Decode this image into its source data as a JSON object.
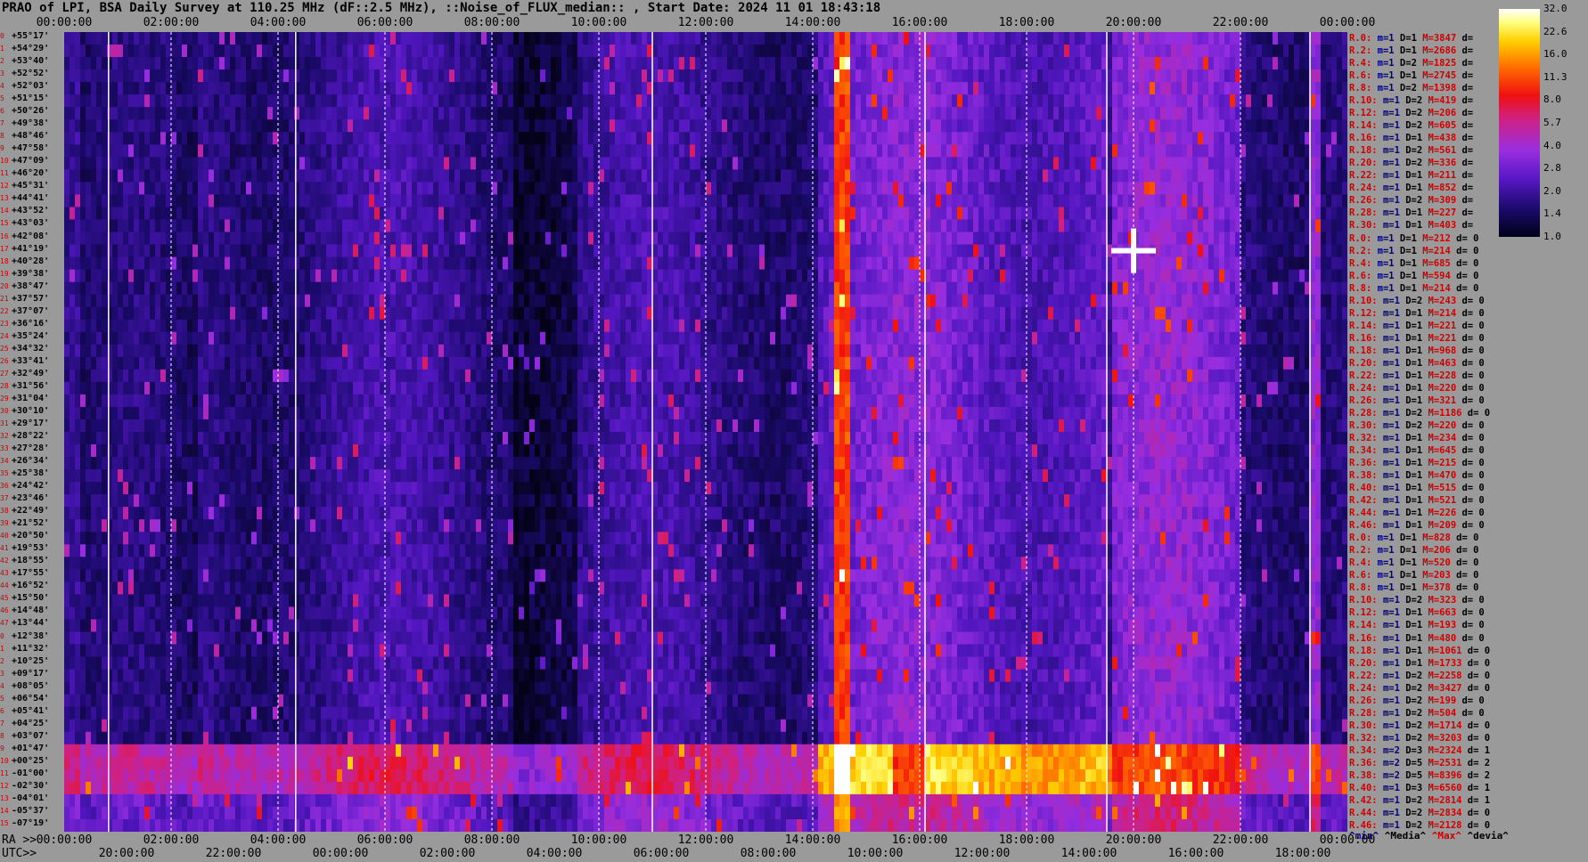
{
  "title": "PRAO of LPI, BSA Daily Survey at 110.25 MHz (dF::2.5 MHz), ::Noise_of_FLUX_median:: , Start Date: 2024 11 01 18:43:18",
  "top_times": [
    "00:00:00",
    "02:00:00",
    "04:00:00",
    "06:00:00",
    "08:00:00",
    "10:00:00",
    "12:00:00",
    "14:00:00",
    "16:00:00",
    "18:00:00",
    "20:00:00",
    "22:00:00",
    "00:00:00"
  ],
  "bottom_ra_label": "RA >>",
  "bottom_ra_times": [
    "00:00:00",
    "02:00:00",
    "04:00:00",
    "06:00:00",
    "08:00:00",
    "10:00:00",
    "12:00:00",
    "14:00:00",
    "16:00:00",
    "18:00:00",
    "20:00:00",
    "22:00:00",
    "00:00:00"
  ],
  "bottom_utc_label": "UTC>>",
  "bottom_utc_times": [
    "20:00:00",
    "22:00:00",
    "00:00:00",
    "02:00:00",
    "04:00:00",
    "06:00:00",
    "08:00:00",
    "10:00:00",
    "12:00:00",
    "14:00:00",
    "16:00:00",
    "18:00:00"
  ],
  "declinations": [
    "+55°17'",
    "+54°29'",
    "+53°40'",
    "+52°52'",
    "+52°03'",
    "+51°15'",
    "+50°26'",
    "+49°38'",
    "+48°46'",
    "+47°58'",
    "+47°09'",
    "+46°20'",
    "+45°31'",
    "+44°41'",
    "+43°52'",
    "+43°03'",
    "+42°08'",
    "+41°19'",
    "+40°28'",
    "+39°38'",
    "+38°47'",
    "+37°57'",
    "+37°07'",
    "+36°16'",
    "+35°24'",
    "+34°32'",
    "+33°41'",
    "+32°49'",
    "+31°56'",
    "+31°04'",
    "+30°10'",
    "+29°17'",
    "+28°22'",
    "+27°28'",
    "+26°34'",
    "+25°38'",
    "+24°42'",
    "+23°46'",
    "+22°49'",
    "+21°52'",
    "+20°50'",
    "+19°53'",
    "+18°55'",
    "+17°55'",
    "+16°52'",
    "+15°50'",
    "+14°48'",
    "+13°44'",
    "+12°38'",
    "+11°32'",
    "+10°25'",
    "+09°17'",
    "+08°05'",
    "+06°54'",
    "+05°41'",
    "+04°25'",
    "+03°07'",
    "+01°47'",
    "+00°25'",
    "-01°00'",
    "-02°30'",
    "-04°01'",
    "-05°37'",
    "-07°19'"
  ],
  "row_numbers": [
    "0",
    "1",
    "2",
    "3",
    "4",
    "5",
    "6",
    "7",
    "8",
    "9",
    "10",
    "11",
    "12",
    "13",
    "14",
    "15",
    "16",
    "17",
    "18",
    "19",
    "20",
    "21",
    "22",
    "23",
    "24",
    "25",
    "26",
    "27",
    "28",
    "29",
    "30",
    "31",
    "32",
    "33",
    "34",
    "35",
    "36",
    "37",
    "38",
    "39",
    "40",
    "41",
    "42",
    "43",
    "44",
    "45",
    "46",
    "47",
    "0",
    "1",
    "2",
    "3",
    "4",
    "5",
    "6",
    "7",
    "8",
    "9",
    "10",
    "11",
    "12",
    "13",
    "14",
    "15"
  ],
  "stats": [
    [
      "R.0:",
      "m=1",
      "D=1",
      "M=3847",
      "d="
    ],
    [
      "R.2:",
      "m=1",
      "D=1",
      "M=2686",
      "d="
    ],
    [
      "R.4:",
      "m=1",
      "D=2",
      "M=1825",
      "d="
    ],
    [
      "R.6:",
      "m=1",
      "D=1",
      "M=2745",
      "d="
    ],
    [
      "R.8:",
      "m=1",
      "D=2",
      "M=1398",
      "d="
    ],
    [
      "R.10:",
      "m=1",
      "D=2",
      "M=419",
      "d="
    ],
    [
      "R.12:",
      "m=1",
      "D=2",
      "M=206",
      "d="
    ],
    [
      "R.14:",
      "m=1",
      "D=2",
      "M=605",
      "d="
    ],
    [
      "R.16:",
      "m=1",
      "D=1",
      "M=438",
      "d="
    ],
    [
      "R.18:",
      "m=1",
      "D=2",
      "M=561",
      "d="
    ],
    [
      "R.20:",
      "m=1",
      "D=2",
      "M=336",
      "d="
    ],
    [
      "R.22:",
      "m=1",
      "D=1",
      "M=211",
      "d="
    ],
    [
      "R.24:",
      "m=1",
      "D=1",
      "M=852",
      "d="
    ],
    [
      "R.26:",
      "m=1",
      "D=2",
      "M=309",
      "d="
    ],
    [
      "R.28:",
      "m=1",
      "D=1",
      "M=227",
      "d="
    ],
    [
      "R.30:",
      "m=1",
      "D=1",
      "M=403",
      "d="
    ],
    [
      "R.0:",
      "m=1",
      "D=1",
      "M=212",
      "d= 0"
    ],
    [
      "R.2:",
      "m=1",
      "D=1",
      "M=214",
      "d= 0"
    ],
    [
      "R.4:",
      "m=1",
      "D=1",
      "M=685",
      "d= 0"
    ],
    [
      "R.6:",
      "m=1",
      "D=1",
      "M=594",
      "d= 0"
    ],
    [
      "R.8:",
      "m=1",
      "D=1",
      "M=214",
      "d= 0"
    ],
    [
      "R.10:",
      "m=1",
      "D=2",
      "M=243",
      "d= 0"
    ],
    [
      "R.12:",
      "m=1",
      "D=1",
      "M=214",
      "d= 0"
    ],
    [
      "R.14:",
      "m=1",
      "D=1",
      "M=221",
      "d= 0"
    ],
    [
      "R.16:",
      "m=1",
      "D=1",
      "M=221",
      "d= 0"
    ],
    [
      "R.18:",
      "m=1",
      "D=1",
      "M=968",
      "d= 0"
    ],
    [
      "R.20:",
      "m=1",
      "D=1",
      "M=463",
      "d= 0"
    ],
    [
      "R.22:",
      "m=1",
      "D=1",
      "M=228",
      "d= 0"
    ],
    [
      "R.24:",
      "m=1",
      "D=1",
      "M=220",
      "d= 0"
    ],
    [
      "R.26:",
      "m=1",
      "D=1",
      "M=321",
      "d= 0"
    ],
    [
      "R.28:",
      "m=1",
      "D=2",
      "M=1186",
      "d= 0"
    ],
    [
      "R.30:",
      "m=1",
      "D=2",
      "M=220",
      "d= 0"
    ],
    [
      "R.32:",
      "m=1",
      "D=1",
      "M=234",
      "d= 0"
    ],
    [
      "R.34:",
      "m=1",
      "D=1",
      "M=645",
      "d= 0"
    ],
    [
      "R.36:",
      "m=1",
      "D=1",
      "M=215",
      "d= 0"
    ],
    [
      "R.38:",
      "m=1",
      "D=1",
      "M=470",
      "d= 0"
    ],
    [
      "R.40:",
      "m=1",
      "D=1",
      "M=515",
      "d= 0"
    ],
    [
      "R.42:",
      "m=1",
      "D=1",
      "M=521",
      "d= 0"
    ],
    [
      "R.44:",
      "m=1",
      "D=1",
      "M=226",
      "d= 0"
    ],
    [
      "R.46:",
      "m=1",
      "D=1",
      "M=209",
      "d= 0"
    ],
    [
      "R.0:",
      "m=1",
      "D=1",
      "M=828",
      "d= 0"
    ],
    [
      "R.2:",
      "m=1",
      "D=1",
      "M=206",
      "d= 0"
    ],
    [
      "R.4:",
      "m=1",
      "D=1",
      "M=520",
      "d= 0"
    ],
    [
      "R.6:",
      "m=1",
      "D=1",
      "M=203",
      "d= 0"
    ],
    [
      "R.8:",
      "m=1",
      "D=1",
      "M=378",
      "d= 0"
    ],
    [
      "R.10:",
      "m=1",
      "D=2",
      "M=323",
      "d= 0"
    ],
    [
      "R.12:",
      "m=1",
      "D=1",
      "M=663",
      "d= 0"
    ],
    [
      "R.14:",
      "m=1",
      "D=1",
      "M=193",
      "d= 0"
    ],
    [
      "R.16:",
      "m=1",
      "D=1",
      "M=480",
      "d= 0"
    ],
    [
      "R.18:",
      "m=1",
      "D=1",
      "M=1061",
      "d= 0"
    ],
    [
      "R.20:",
      "m=1",
      "D=1",
      "M=1733",
      "d= 0"
    ],
    [
      "R.22:",
      "m=1",
      "D=2",
      "M=2258",
      "d= 0"
    ],
    [
      "R.24:",
      "m=1",
      "D=2",
      "M=3427",
      "d= 0"
    ],
    [
      "R.26:",
      "m=1",
      "D=2",
      "M=199",
      "d= 0"
    ],
    [
      "R.28:",
      "m=1",
      "D=2",
      "M=504",
      "d= 0"
    ],
    [
      "R.30:",
      "m=1",
      "D=2",
      "M=1714",
      "d= 0"
    ],
    [
      "R.32:",
      "m=1",
      "D=2",
      "M=3203",
      "d= 0"
    ],
    [
      "R.34:",
      "m=2",
      "D=3",
      "M=2324",
      "d= 1"
    ],
    [
      "R.36:",
      "m=2",
      "D=5",
      "M=2531",
      "d= 2"
    ],
    [
      "R.38:",
      "m=2",
      "D=5",
      "M=8396",
      "d= 2"
    ],
    [
      "R.40:",
      "m=1",
      "D=3",
      "M=6560",
      "d= 1"
    ],
    [
      "R.42:",
      "m=1",
      "D=2",
      "M=2814",
      "d= 1"
    ],
    [
      "R.44:",
      "m=1",
      "D=2",
      "M=2834",
      "d= 0"
    ],
    [
      "R.46:",
      "m=1",
      "D=2",
      "M=2128",
      "d= 0"
    ]
  ],
  "footer": {
    "min": "^min^",
    "median": "^Media^",
    "max": "^Max^",
    "devia": "^devia^"
  },
  "colorbar": {
    "labels": [
      "32.0",
      "22.6",
      "16.0",
      "11.3",
      "8.0",
      "5.7",
      "4.0",
      "2.8",
      "2.0",
      "1.4",
      "1.0"
    ]
  },
  "colors": {
    "background": "#9a9a9a",
    "row_number": "#d00000",
    "max_label": "#d00000",
    "min_label": "#000080"
  },
  "chart_data": {
    "type": "heatmap",
    "title": "PRAO of LPI, BSA Daily Survey at 110.25 MHz (dF::2.5 MHz), ::Noise_of_FLUX_median:: , Start Date: 2024 11 01 18:43:18",
    "x_axis": "RA / UTC",
    "y_axis": "Declination",
    "colorscale": {
      "min": 1.0,
      "max": 32.0,
      "scale": "log2",
      "ticks": [
        1.0,
        1.4,
        2.0,
        2.8,
        4.0,
        5.7,
        8.0,
        11.3,
        16.0,
        22.6,
        32.0
      ]
    },
    "features": [
      {
        "type": "strong vertical band",
        "ra_hours": 14.5
      },
      {
        "type": "bright horizontal band",
        "dec_range": [
          "+01°47'",
          "-02°30'"
        ]
      },
      {
        "type": "bright source",
        "ra_hours": 20.0,
        "dec": "+41°19'"
      },
      {
        "type": "bright source column",
        "ra_hours": 23.3
      }
    ]
  }
}
